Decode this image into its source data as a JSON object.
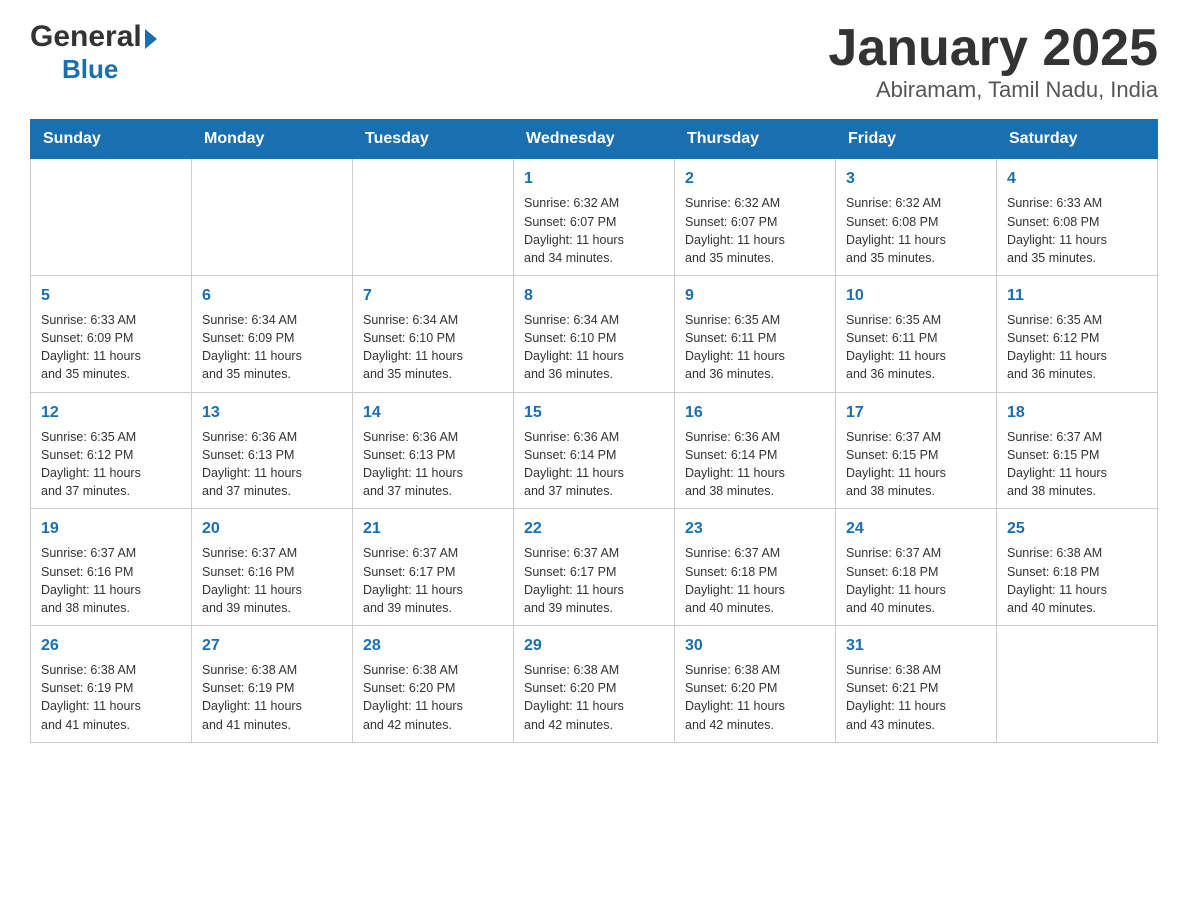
{
  "header": {
    "logo_general": "General",
    "logo_blue": "Blue",
    "month_title": "January 2025",
    "location": "Abiramam, Tamil Nadu, India"
  },
  "weekdays": [
    "Sunday",
    "Monday",
    "Tuesday",
    "Wednesday",
    "Thursday",
    "Friday",
    "Saturday"
  ],
  "weeks": [
    [
      {
        "day": "",
        "info": ""
      },
      {
        "day": "",
        "info": ""
      },
      {
        "day": "",
        "info": ""
      },
      {
        "day": "1",
        "info": "Sunrise: 6:32 AM\nSunset: 6:07 PM\nDaylight: 11 hours\nand 34 minutes."
      },
      {
        "day": "2",
        "info": "Sunrise: 6:32 AM\nSunset: 6:07 PM\nDaylight: 11 hours\nand 35 minutes."
      },
      {
        "day": "3",
        "info": "Sunrise: 6:32 AM\nSunset: 6:08 PM\nDaylight: 11 hours\nand 35 minutes."
      },
      {
        "day": "4",
        "info": "Sunrise: 6:33 AM\nSunset: 6:08 PM\nDaylight: 11 hours\nand 35 minutes."
      }
    ],
    [
      {
        "day": "5",
        "info": "Sunrise: 6:33 AM\nSunset: 6:09 PM\nDaylight: 11 hours\nand 35 minutes."
      },
      {
        "day": "6",
        "info": "Sunrise: 6:34 AM\nSunset: 6:09 PM\nDaylight: 11 hours\nand 35 minutes."
      },
      {
        "day": "7",
        "info": "Sunrise: 6:34 AM\nSunset: 6:10 PM\nDaylight: 11 hours\nand 35 minutes."
      },
      {
        "day": "8",
        "info": "Sunrise: 6:34 AM\nSunset: 6:10 PM\nDaylight: 11 hours\nand 36 minutes."
      },
      {
        "day": "9",
        "info": "Sunrise: 6:35 AM\nSunset: 6:11 PM\nDaylight: 11 hours\nand 36 minutes."
      },
      {
        "day": "10",
        "info": "Sunrise: 6:35 AM\nSunset: 6:11 PM\nDaylight: 11 hours\nand 36 minutes."
      },
      {
        "day": "11",
        "info": "Sunrise: 6:35 AM\nSunset: 6:12 PM\nDaylight: 11 hours\nand 36 minutes."
      }
    ],
    [
      {
        "day": "12",
        "info": "Sunrise: 6:35 AM\nSunset: 6:12 PM\nDaylight: 11 hours\nand 37 minutes."
      },
      {
        "day": "13",
        "info": "Sunrise: 6:36 AM\nSunset: 6:13 PM\nDaylight: 11 hours\nand 37 minutes."
      },
      {
        "day": "14",
        "info": "Sunrise: 6:36 AM\nSunset: 6:13 PM\nDaylight: 11 hours\nand 37 minutes."
      },
      {
        "day": "15",
        "info": "Sunrise: 6:36 AM\nSunset: 6:14 PM\nDaylight: 11 hours\nand 37 minutes."
      },
      {
        "day": "16",
        "info": "Sunrise: 6:36 AM\nSunset: 6:14 PM\nDaylight: 11 hours\nand 38 minutes."
      },
      {
        "day": "17",
        "info": "Sunrise: 6:37 AM\nSunset: 6:15 PM\nDaylight: 11 hours\nand 38 minutes."
      },
      {
        "day": "18",
        "info": "Sunrise: 6:37 AM\nSunset: 6:15 PM\nDaylight: 11 hours\nand 38 minutes."
      }
    ],
    [
      {
        "day": "19",
        "info": "Sunrise: 6:37 AM\nSunset: 6:16 PM\nDaylight: 11 hours\nand 38 minutes."
      },
      {
        "day": "20",
        "info": "Sunrise: 6:37 AM\nSunset: 6:16 PM\nDaylight: 11 hours\nand 39 minutes."
      },
      {
        "day": "21",
        "info": "Sunrise: 6:37 AM\nSunset: 6:17 PM\nDaylight: 11 hours\nand 39 minutes."
      },
      {
        "day": "22",
        "info": "Sunrise: 6:37 AM\nSunset: 6:17 PM\nDaylight: 11 hours\nand 39 minutes."
      },
      {
        "day": "23",
        "info": "Sunrise: 6:37 AM\nSunset: 6:18 PM\nDaylight: 11 hours\nand 40 minutes."
      },
      {
        "day": "24",
        "info": "Sunrise: 6:37 AM\nSunset: 6:18 PM\nDaylight: 11 hours\nand 40 minutes."
      },
      {
        "day": "25",
        "info": "Sunrise: 6:38 AM\nSunset: 6:18 PM\nDaylight: 11 hours\nand 40 minutes."
      }
    ],
    [
      {
        "day": "26",
        "info": "Sunrise: 6:38 AM\nSunset: 6:19 PM\nDaylight: 11 hours\nand 41 minutes."
      },
      {
        "day": "27",
        "info": "Sunrise: 6:38 AM\nSunset: 6:19 PM\nDaylight: 11 hours\nand 41 minutes."
      },
      {
        "day": "28",
        "info": "Sunrise: 6:38 AM\nSunset: 6:20 PM\nDaylight: 11 hours\nand 42 minutes."
      },
      {
        "day": "29",
        "info": "Sunrise: 6:38 AM\nSunset: 6:20 PM\nDaylight: 11 hours\nand 42 minutes."
      },
      {
        "day": "30",
        "info": "Sunrise: 6:38 AM\nSunset: 6:20 PM\nDaylight: 11 hours\nand 42 minutes."
      },
      {
        "day": "31",
        "info": "Sunrise: 6:38 AM\nSunset: 6:21 PM\nDaylight: 11 hours\nand 43 minutes."
      },
      {
        "day": "",
        "info": ""
      }
    ]
  ]
}
